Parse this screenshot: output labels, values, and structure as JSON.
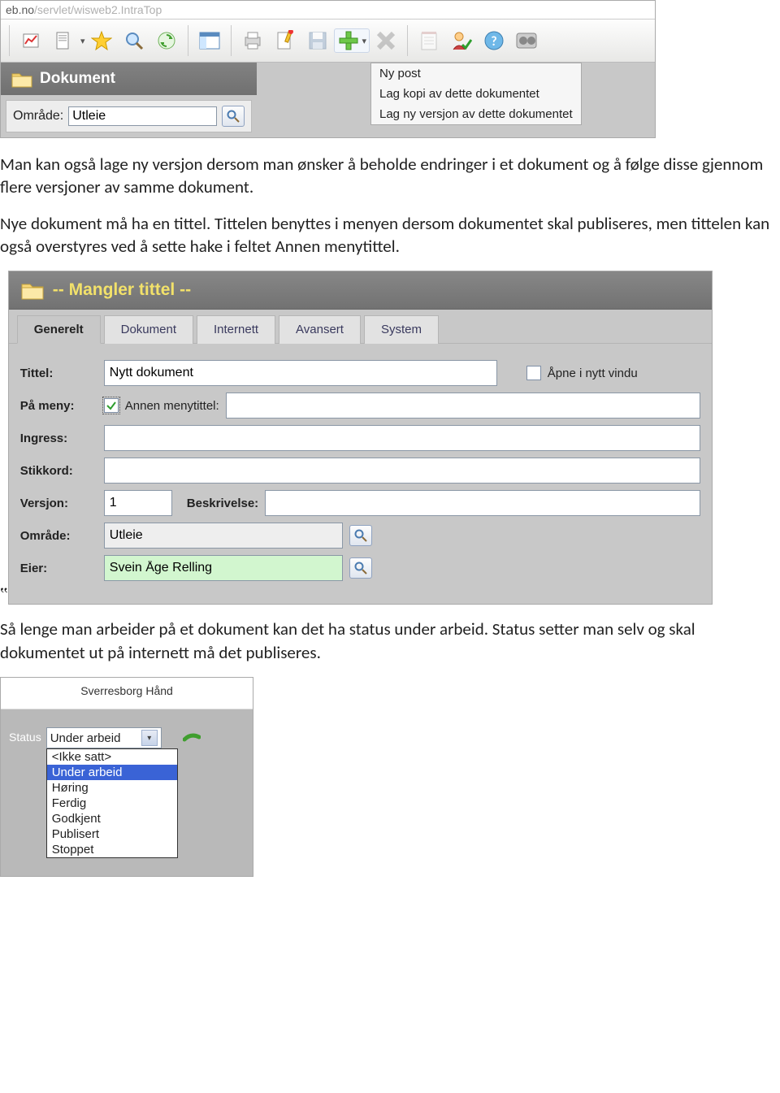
{
  "address_bar": {
    "faded": "eb.no",
    "path": "/servlet/wisweb2.IntraTop"
  },
  "toolbar_icons": [
    "chart",
    "document",
    "star",
    "magnifier",
    "recycle",
    "window",
    "print",
    "edit-doc",
    "save",
    "add",
    "delete",
    "notepad",
    "user-check",
    "help",
    "video"
  ],
  "add_menu": {
    "items": [
      "Ny post",
      "Lag kopi av dette dokumentet",
      "Lag ny versjon av dette dokumentet"
    ]
  },
  "left_panel": {
    "title": "Dokument",
    "omrade_label": "Område:",
    "omrade_value": "Utleie"
  },
  "paragraph1": "Man kan også lage ny versjon dersom man ønsker å beholde endringer i et dokument og å følge disse gjennom flere versjoner av samme dokument.",
  "paragraph2": "Nye dokument må ha en tittel. Tittelen benyttes i menyen dersom dokumentet skal publiseres, men tittelen kan også overstyres ved å sette hake i feltet Annen menytittel.",
  "form": {
    "header": "-- Mangler tittel --",
    "tabs": [
      "Generelt",
      "Dokument",
      "Internett",
      "Avansert",
      "System"
    ],
    "active_tab": 0,
    "labels": {
      "tittel": "Tittel:",
      "apne": "Åpne i nytt vindu",
      "pameny": "På meny:",
      "annen": "Annen menytittel:",
      "ingress": "Ingress:",
      "stikkord": "Stikkord:",
      "versjon": "Versjon:",
      "beskrivelse": "Beskrivelse:",
      "omrade": "Område:",
      "eier": "Eier:"
    },
    "values": {
      "tittel": "Nytt dokument",
      "annen_checked": true,
      "annen_value": "",
      "ingress": "",
      "stikkord": "",
      "versjon": "1",
      "beskrivelse": "",
      "omrade": "Utleie",
      "eier": "Svein Åge Relling"
    }
  },
  "paragraph3": "Så lenge man arbeider på et dokument kan det ha status under arbeid. Status setter man selv og skal dokumentet ut på internett må det publiseres.",
  "status": {
    "header": "Sverresborg Hånd",
    "label": "Status",
    "selected": "Under arbeid",
    "options": [
      "<Ikke satt>",
      "Under arbeid",
      "Høring",
      "Ferdig",
      "Godkjent",
      "Publisert",
      "Stoppet"
    ],
    "highlighted_index": 1
  }
}
